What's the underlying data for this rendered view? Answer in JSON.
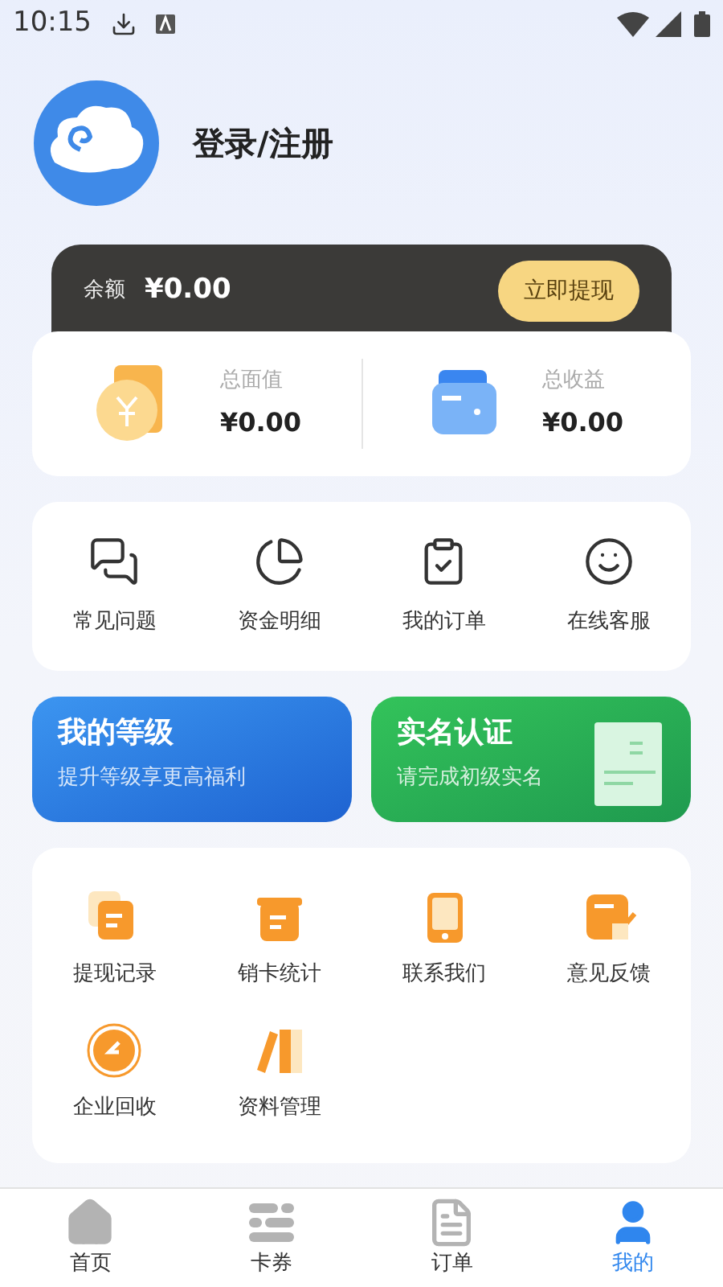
{
  "status_bar": {
    "time": "10:15"
  },
  "profile": {
    "login_label": "登录/注册"
  },
  "balance": {
    "label": "余额",
    "amount": "¥0.00",
    "button": "立即提现"
  },
  "stats": [
    {
      "label": "总面值",
      "amount": "¥0.00"
    },
    {
      "label": "总收益",
      "amount": "¥0.00"
    }
  ],
  "quick_menu": [
    {
      "label": "常见问题"
    },
    {
      "label": "资金明细"
    },
    {
      "label": "我的订单"
    },
    {
      "label": "在线客服"
    }
  ],
  "banners": [
    {
      "kind": "level",
      "title": "我的等级",
      "subtitle": "提升等级享更高福利"
    },
    {
      "kind": "verify",
      "title": "实名认证",
      "subtitle": "请完成初级实名"
    }
  ],
  "services": [
    {
      "label": "提现记录"
    },
    {
      "label": "销卡统计"
    },
    {
      "label": "联系我们"
    },
    {
      "label": "意见反馈"
    },
    {
      "label": "企业回收"
    },
    {
      "label": "资料管理"
    }
  ],
  "tab_bar": [
    {
      "label": "首页",
      "selected": false
    },
    {
      "label": "卡券",
      "selected": false
    },
    {
      "label": "订单",
      "selected": false
    },
    {
      "label": "我的",
      "selected": true
    }
  ]
}
